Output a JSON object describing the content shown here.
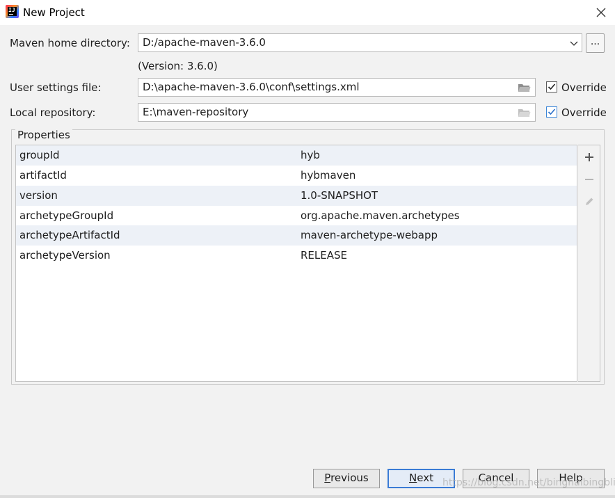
{
  "window": {
    "title": "New Project",
    "app_icon_text": "IJ"
  },
  "maven_home": {
    "label": "Maven home directory:",
    "value": "D:/apache-maven-3.6.0",
    "browse_label": "...",
    "version_note": "(Version: 3.6.0)"
  },
  "user_settings": {
    "label": "User settings file:",
    "value": "D:\\apache-maven-3.6.0\\conf\\settings.xml",
    "override_label": "Override",
    "override_checked": true
  },
  "local_repo": {
    "label": "Local repository:",
    "value": "E:\\maven-repository",
    "override_label": "Override",
    "override_checked": true
  },
  "properties": {
    "title": "Properties",
    "rows": [
      {
        "key": "groupId",
        "value": "hyb"
      },
      {
        "key": "artifactId",
        "value": "hybmaven"
      },
      {
        "key": "version",
        "value": "1.0-SNAPSHOT"
      },
      {
        "key": "archetypeGroupId",
        "value": "org.apache.maven.archetypes"
      },
      {
        "key": "archetypeArtifactId",
        "value": "maven-archetype-webapp"
      },
      {
        "key": "archetypeVersion",
        "value": "RELEASE"
      }
    ],
    "tools": [
      "add-icon",
      "remove-icon",
      "edit-icon"
    ]
  },
  "buttons": {
    "previous": {
      "first": "P",
      "rest": "revious"
    },
    "next": {
      "first": "N",
      "rest": "ext"
    },
    "cancel": "Cancel",
    "help": "Help"
  },
  "watermark": "https://blog.csdn.net/binghaibingbling",
  "colors": {
    "accent": "#3a7bd5",
    "row_stripe": "#edf1f7",
    "checkbox_blue": "#3c86d8"
  }
}
